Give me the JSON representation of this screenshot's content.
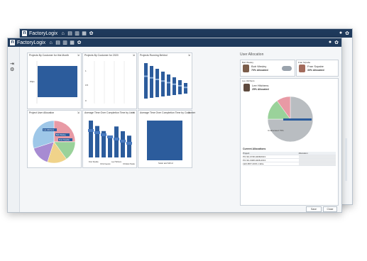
{
  "app": {
    "brand": "FactoryLogix",
    "toolbar_icons": [
      "home-icon",
      "report-icon",
      "document-icon",
      "calendar-icon",
      "settings-icon",
      "gear-icon"
    ]
  },
  "panels": {
    "p1": {
      "title": "Projects By Customer for this Month"
    },
    "p2": {
      "title": "Projects By Customer for 2020"
    },
    "p3": {
      "title": "Projects Running Behind"
    },
    "p4": {
      "title": "Project User Allocation"
    },
    "p5": {
      "title": "Average Time Over Completion Time by User"
    },
    "p6": {
      "title": "Average Time Over Completion Time by Customer"
    }
  },
  "allocation": {
    "title": "User Allocation",
    "users": [
      {
        "label": "Bob Wesley",
        "name": "Bob Wesley",
        "alloc": "70% Allocated"
      },
      {
        "label": "Fran Szpabe",
        "name": "Fran Szpabe",
        "alloc": "30% Allocated"
      }
    ],
    "selected": {
      "label": "Lee Hitchens",
      "name": "Lee Hitchens",
      "alloc": "25% Allocated"
    },
    "current_title": "Current Allocations",
    "table_headers": [
      "Project",
      "Allocation"
    ],
    "table_rows": [
      [
        "PO-SF-0748-0408/2013",
        ""
      ],
      [
        "PO-SF-0408-0408-2013",
        ""
      ],
      [
        "LED-BKT-2015-1 Elite",
        ""
      ]
    ],
    "save": "Save",
    "close": "Close"
  },
  "chart_data": [
    {
      "type": "bar",
      "title": "Projects By Customer for this Month",
      "categories": [
        "Wips"
      ],
      "values": [
        1
      ]
    },
    {
      "type": "bar",
      "title": "Projects By Customer for 2020",
      "categories": [],
      "values": []
    },
    {
      "type": "bar",
      "title": "Projects Running Behind",
      "categories": [
        "A",
        "B",
        "C",
        "D",
        "E",
        "F",
        "G",
        "H"
      ],
      "values": [
        10,
        9,
        8,
        7,
        6,
        5,
        4,
        3
      ]
    },
    {
      "type": "pie",
      "title": "Project User Allocation",
      "series": [
        {
          "name": "Lee Hitchens",
          "value": 25,
          "color": "#e89aa5"
        },
        {
          "name": "Bob Wesley",
          "value": 15,
          "color": "#9ad29a"
        },
        {
          "name": "Fran Szpabe",
          "value": 15,
          "color": "#f0d38a"
        },
        {
          "name": "Other A",
          "value": 15,
          "color": "#a78bd2"
        },
        {
          "name": "Other B",
          "value": 30,
          "color": "#9ec7e8"
        }
      ]
    },
    {
      "type": "bar",
      "title": "Average Time Over Completion Time by User",
      "categories": [
        "Fran Szpabe",
        "Chris Keenan",
        "Lee Hitchens",
        "Christian Tassler"
      ],
      "values": [
        9,
        8,
        7,
        6
      ]
    },
    {
      "type": "bar",
      "title": "Average Time Over Completion Time by Customer",
      "categories": [
        "Solar and Wind"
      ],
      "values": [
        1
      ]
    },
    {
      "type": "pie",
      "title": "Lee Hitchens",
      "series": [
        {
          "name": "Unallocated 75%",
          "value": 75,
          "color": "#b9bdc1"
        },
        {
          "name": "Allocated",
          "value": 15,
          "color": "#9ad29a"
        },
        {
          "name": "Other",
          "value": 10,
          "color": "#e89aa5"
        }
      ]
    }
  ]
}
